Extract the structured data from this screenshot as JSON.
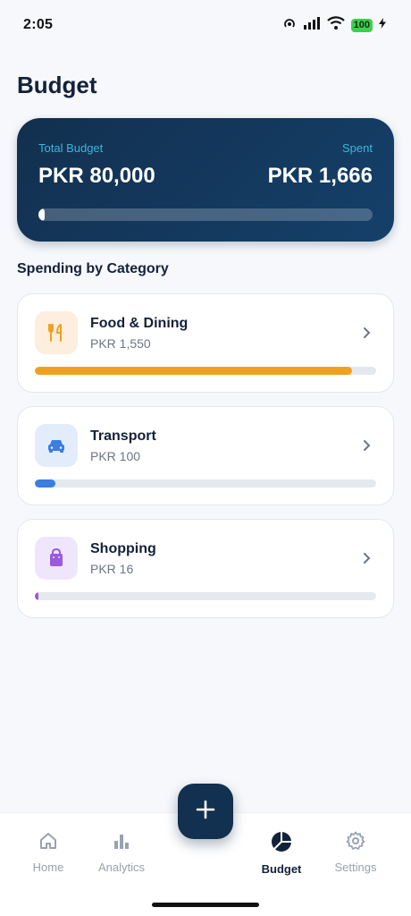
{
  "status_bar": {
    "time": "2:05",
    "battery": "100"
  },
  "page": {
    "title": "Budget"
  },
  "summary": {
    "total_label": "Total Budget",
    "total_value": "PKR 80,000",
    "spent_label": "Spent",
    "spent_value": "PKR 1,666",
    "progress_fraction": 0.02
  },
  "section": {
    "title": "Spending by Category"
  },
  "categories": [
    {
      "name": "Food & Dining",
      "amount": "PKR 1,550",
      "icon": "fork-knife-icon",
      "icon_bg": "#fdeedd",
      "icon_color": "#f0a020",
      "bar_color": "#f0a020",
      "progress_fraction": 0.93
    },
    {
      "name": "Transport",
      "amount": "PKR 100",
      "icon": "car-icon",
      "icon_bg": "#e3ecfb",
      "icon_color": "#3b7de0",
      "bar_color": "#3b7de0",
      "progress_fraction": 0.06
    },
    {
      "name": "Shopping",
      "amount": "PKR 16",
      "icon": "shopping-bag-icon",
      "icon_bg": "#efe6fb",
      "icon_color": "#9a5ae0",
      "bar_color": "#9a5ae0",
      "progress_fraction": 0.01
    }
  ],
  "nav": {
    "items": [
      {
        "label": "Home",
        "icon": "home-icon",
        "active": false
      },
      {
        "label": "Analytics",
        "icon": "bar-chart-icon",
        "active": false
      },
      {
        "label": "Budget",
        "icon": "pie-chart-icon",
        "active": true
      },
      {
        "label": "Settings",
        "icon": "gear-icon",
        "active": false
      }
    ],
    "fab_icon": "plus-icon"
  },
  "colors": {
    "primary": "#12304f",
    "accent_label": "#38b8d8",
    "background": "#f6f8fb"
  }
}
